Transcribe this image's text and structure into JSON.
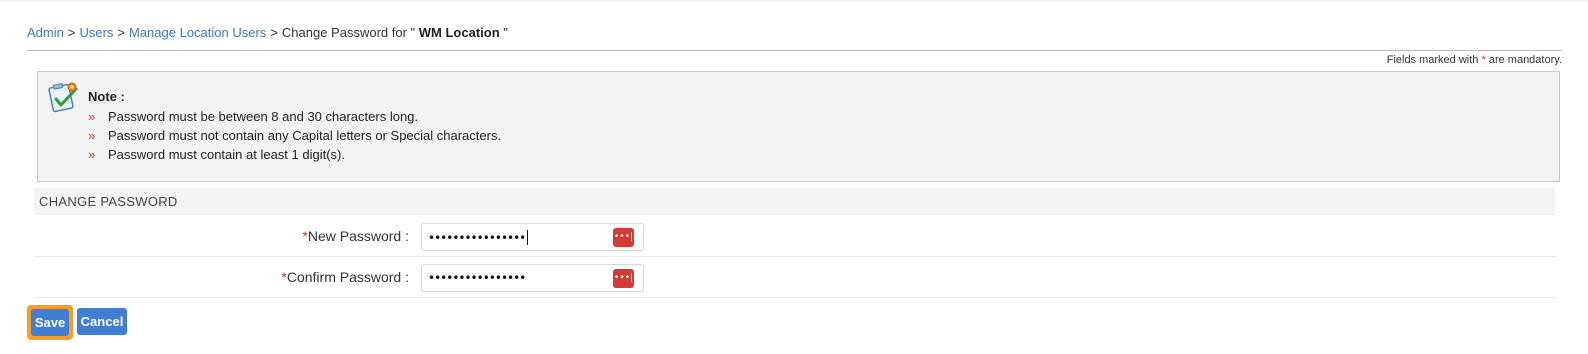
{
  "breadcrumb": {
    "admin": "Admin",
    "users": "Users",
    "manage_location_users": "Manage Location Users",
    "separator": ">",
    "current_prefix": "Change Password for \"",
    "current_name": "WM Location",
    "current_suffix": "\""
  },
  "mandatory_note": {
    "prefix": "Fields marked with",
    "star": "*",
    "suffix": "are mandatory."
  },
  "note": {
    "title": "Note :",
    "bullet": "»",
    "items": [
      "Password must be between 8 and 30 characters long.",
      "Password must not contain any Capital letters or Special characters.",
      "Password must contain at least 1 digit(s)."
    ]
  },
  "section": {
    "title": "CHANGE PASSWORD"
  },
  "form": {
    "required_star": "*",
    "new_password": {
      "label": "New Password :",
      "value": "••••••••••••••••"
    },
    "confirm_password": {
      "label": "Confirm Password :",
      "value": "••••••••••••••••"
    },
    "reveal_glyph": "•••|"
  },
  "buttons": {
    "save": "Save",
    "cancel": "Cancel"
  },
  "colors": {
    "link": "#3a78c8",
    "required": "#d0312d",
    "primary_button": "#3f7ed4",
    "focus_ring": "#f5a023",
    "reveal_button": "#d63a35"
  },
  "icons": {
    "note": "clipboard-check-icon",
    "reveal": "password-reveal-icon"
  }
}
